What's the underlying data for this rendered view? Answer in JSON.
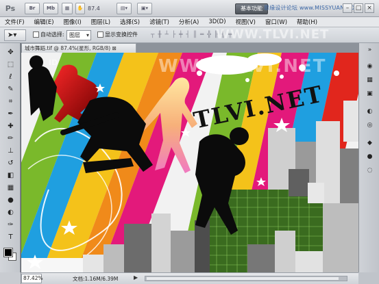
{
  "app": {
    "logo": "Ps",
    "bar_buttons": [
      "Br",
      "Mb"
    ],
    "zoom_display": "87.4",
    "workspace_label": "基本功能",
    "watermark_top": "思缘设计论坛 www.MISSYUAN.COM"
  },
  "menu": [
    "文件(F)",
    "编辑(E)",
    "图像(I)",
    "图层(L)",
    "选择(S)",
    "滤镜(T)",
    "分析(A)",
    "3D(D)",
    "视图(V)",
    "窗口(W)",
    "帮助(H)"
  ],
  "options": {
    "auto_select_label": "自动选择:",
    "auto_select_value": "图层",
    "show_transform_label": "显示变换控件",
    "watermark": "WWW.TLVI.NET"
  },
  "document": {
    "tab_title": "城市舞蹈.tif @ 87.4%(星形, RGB/8) ⊠",
    "canvas_watermark": "WWW.TLVI.NET",
    "canvas_watermark_left": "ID",
    "art_text": "TLVI.NET"
  },
  "status": {
    "zoom": "87.42%",
    "doc_info": "文档:1.16M/6.39M",
    "arrow": "▶"
  },
  "colors": {
    "stripe_green": "#7ab92b",
    "stripe_blue": "#1f9fe0",
    "stripe_yellow": "#f4c21a",
    "stripe_orange": "#f08a1a",
    "stripe_magenta": "#e3197b",
    "stripe_red": "#e1261d",
    "panel": "#c9ccd1"
  }
}
